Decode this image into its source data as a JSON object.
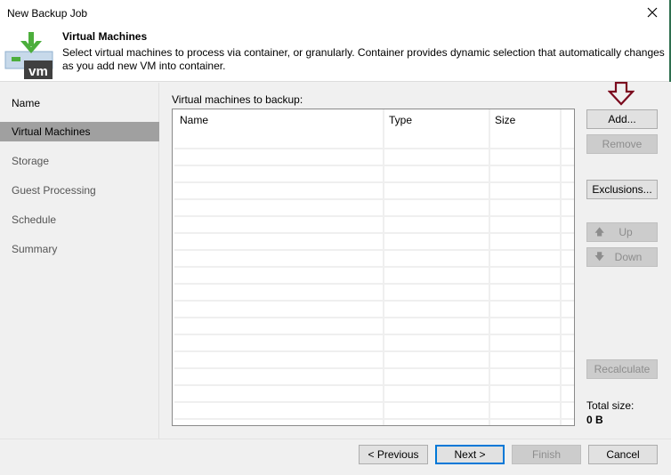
{
  "window": {
    "title": "New Backup Job",
    "close_icon": "close-icon"
  },
  "header": {
    "icon": "vm-download-icon",
    "title": "Virtual Machines",
    "description": "Select virtual machines to process via container, or granularly. Container provides dynamic selection that automatically changes as you add new VM into container."
  },
  "sidebar": {
    "items": [
      {
        "label": "Name",
        "active": false
      },
      {
        "label": "Virtual Machines",
        "active": true
      },
      {
        "label": "Storage",
        "active": false
      },
      {
        "label": "Guest Processing",
        "active": false
      },
      {
        "label": "Schedule",
        "active": false
      },
      {
        "label": "Summary",
        "active": false
      }
    ]
  },
  "vm_list": {
    "label": "Virtual machines to backup:",
    "columns": [
      "Name",
      "Type",
      "Size"
    ],
    "rows": []
  },
  "side_buttons": {
    "add": {
      "label": "Add...",
      "enabled": true
    },
    "remove": {
      "label": "Remove",
      "enabled": false
    },
    "exclusions": {
      "label": "Exclusions...",
      "enabled": true
    },
    "up": {
      "label": "Up",
      "icon": "arrow-up-icon",
      "enabled": false
    },
    "down": {
      "label": "Down",
      "icon": "arrow-down-icon",
      "enabled": false
    },
    "recalculate": {
      "label": "Recalculate",
      "enabled": false
    }
  },
  "annotation": {
    "icon": "arrow-down-marker-icon",
    "color": "#7b0a1e"
  },
  "totals": {
    "label": "Total size:",
    "value": "0 B"
  },
  "footer": {
    "previous": {
      "label": "< Previous",
      "enabled": true
    },
    "next": {
      "label": "Next >",
      "enabled": true,
      "default": true
    },
    "finish": {
      "label": "Finish",
      "enabled": false
    },
    "cancel": {
      "label": "Cancel",
      "enabled": true
    }
  },
  "colors": {
    "accent": "#0078d7",
    "icon_green": "#4cae3c",
    "sidebar_active": "#a0a0a0"
  }
}
